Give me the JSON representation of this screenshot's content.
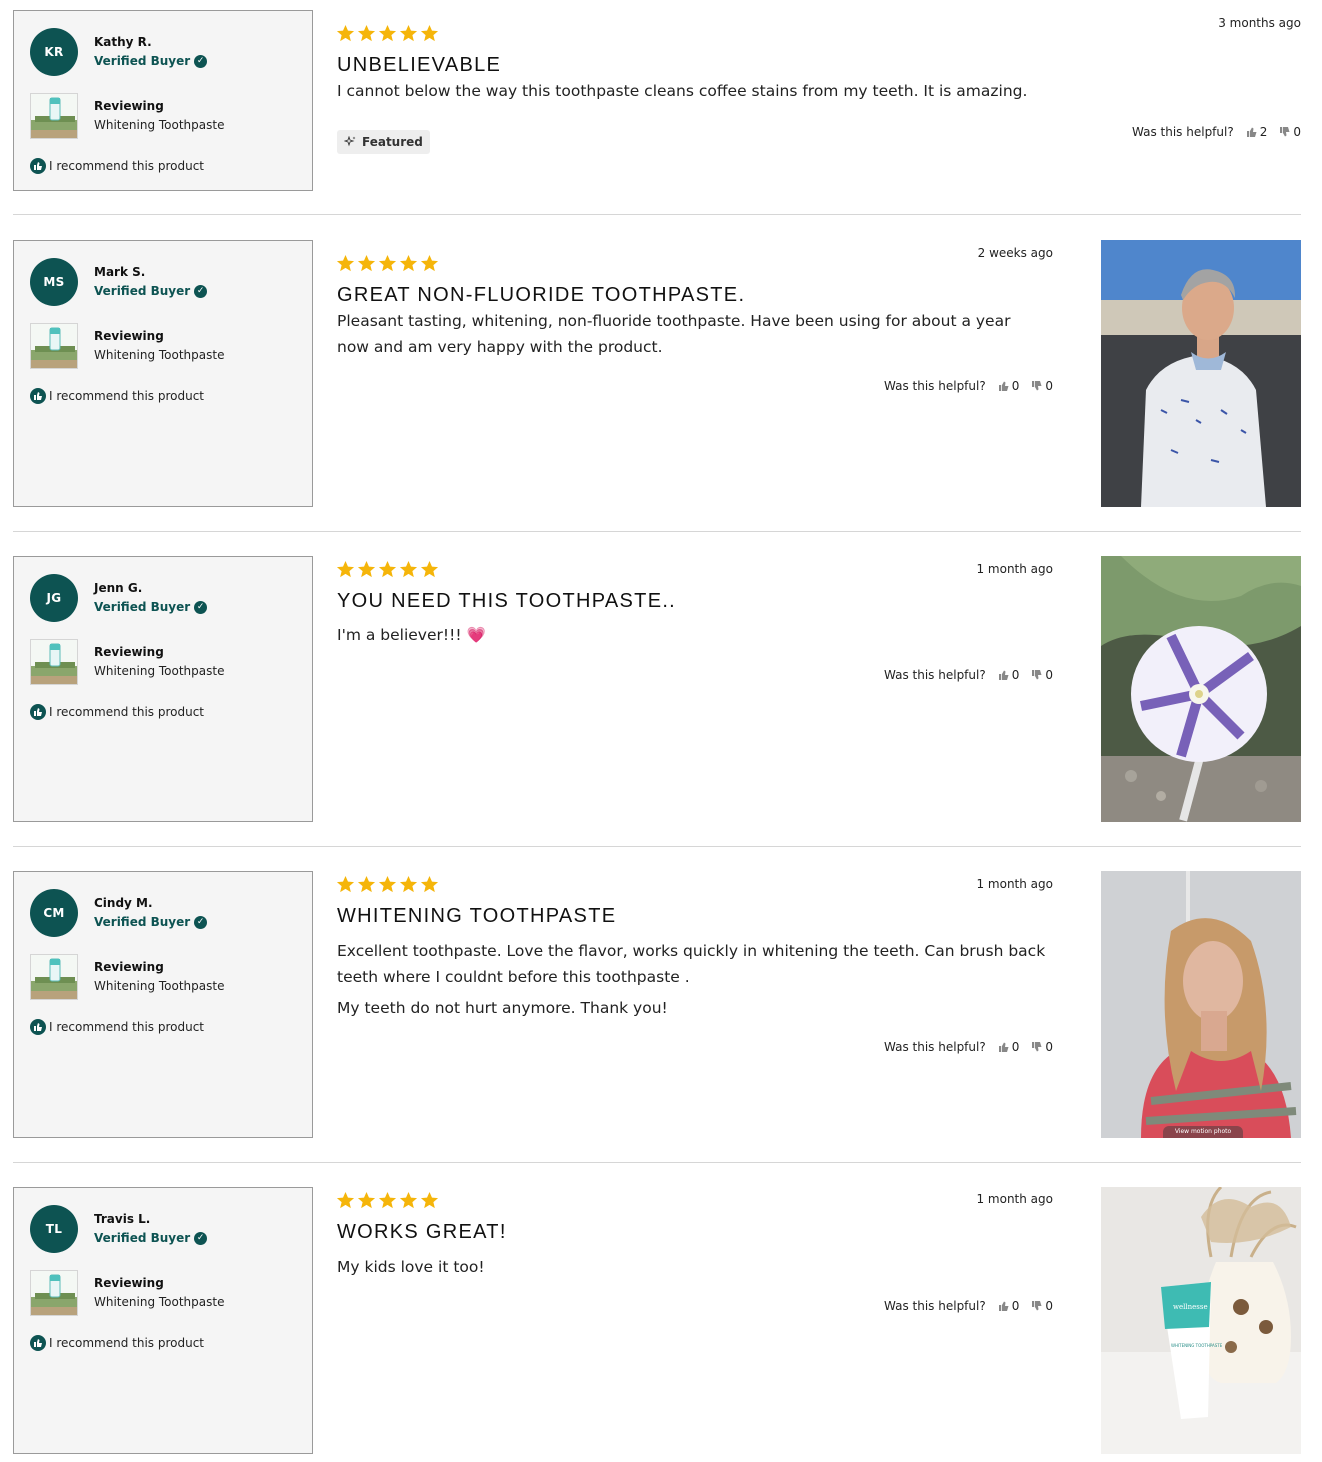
{
  "colors": {
    "brand": "#0d5352",
    "star": "#f5b50a",
    "box_bg": "#f5f5f5"
  },
  "labels": {
    "verified": "Verified Buyer",
    "reviewing": "Reviewing",
    "recommend": "I recommend this product",
    "helpful": "Was this helpful?",
    "featured": "Featured"
  },
  "reviews": [
    {
      "initials": "KR",
      "name": "Kathy R.",
      "product": "Whitening Toothpaste",
      "rating": 5,
      "date": "3 months ago",
      "title": "UNBELIEVABLE",
      "body": [
        "I cannot below the way this toothpaste cleans coffee stains from my teeth. It is amazing."
      ],
      "helpful_up": "2",
      "helpful_down": "0",
      "featured": true
    },
    {
      "initials": "MS",
      "name": "Mark S.",
      "product": "Whitening Toothpaste",
      "rating": 5,
      "date": "2 weeks ago",
      "title": "GREAT NON-FLUORIDE TOOTHPASTE.",
      "body": [
        "Pleasant tasting, whitening, non-fluoride toothpaste. Have been using for about a year now and am very happy with the product."
      ],
      "helpful_up": "0",
      "helpful_down": "0",
      "photo": "man-in-sweater"
    },
    {
      "initials": "JG",
      "name": "Jenn G.",
      "product": "Whitening Toothpaste",
      "rating": 5,
      "date": "1 month ago",
      "title": "YOU NEED THIS TOOTHPASTE..",
      "body": [
        "I'm a believer!!! 💗"
      ],
      "helpful_up": "0",
      "helpful_down": "0",
      "photo": "morning-glory-flower"
    },
    {
      "initials": "CM",
      "name": "Cindy M.",
      "product": "Whitening Toothpaste",
      "rating": 5,
      "date": "1 month ago",
      "title": "WHITENING TOOTHPASTE",
      "body": [
        "Excellent toothpaste. Love the flavor, works quickly in whitening the teeth. Can brush back teeth where I couldnt before this toothpaste .",
        "My teeth do not hurt anymore. Thank you!"
      ],
      "helpful_up": "0",
      "helpful_down": "0",
      "photo": "woman-selfie",
      "photo_caption": "View motion photo"
    },
    {
      "initials": "TL",
      "name": "Travis L.",
      "product": "Whitening Toothpaste",
      "rating": 5,
      "date": "1 month ago",
      "title": "WORKS GREAT!",
      "body": [
        "My kids love it too!"
      ],
      "helpful_up": "0",
      "helpful_down": "0",
      "photo": "toothpaste-tube-vase",
      "photo_text": {
        "brand": "wellnesse",
        "product": "WHITENING TOOTHPASTE"
      }
    }
  ]
}
